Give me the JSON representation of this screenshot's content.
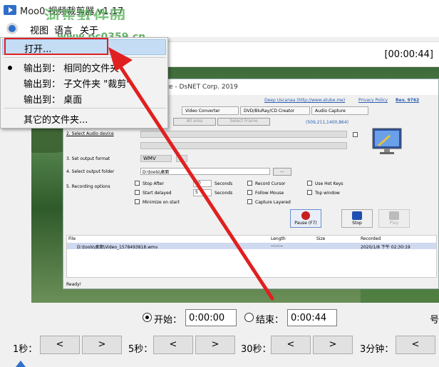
{
  "window": {
    "title": "Moo0 视频裁剪器 v1.17"
  },
  "watermark": {
    "text": "河东软件园",
    "url": "www.pc0359.cn"
  },
  "menubar": {
    "items": [
      "视图",
      "语言",
      "关于"
    ]
  },
  "time_readout": "[00:00:44]",
  "dropdown": {
    "open_label": "打开...",
    "output_same": "输出到：  相同的文件夹",
    "output_sub": "输出到：  子文件夹 \"裁剪\"",
    "output_desktop": "输出到：  桌面",
    "other_folder": "其它的文件夹...",
    "selected": "output_same"
  },
  "embedded_app": {
    "title_fragment": "ite - DsNET Corp. 2019",
    "link_1": "Deep Uscanaa (http://www.atube.me)",
    "link_2": "Privacy Policy",
    "link_3": "Rev. 9762",
    "tabs": [
      "Video Converter",
      "DVD/BluRay/CD Creator",
      "Audio Capture"
    ],
    "btn_all_area": "All area",
    "btn_select_frame": "Select Frame",
    "coords": "(509,211,1400,864)",
    "label_audio": "2. Select Audio device",
    "label_format": "3. Set output format",
    "format_value": "WMV",
    "label_folder": "4. Select output folder",
    "folder_value": "D:\\tools\\桌面",
    "browse": "...",
    "label_rec_options": "5. Recording options",
    "opt_stop_after": "Stop After",
    "stop_after_value": "60",
    "seconds_1": "Seconds",
    "opt_start_delayed": "Start delayed",
    "delay_value": "5",
    "seconds_2": "Seconds",
    "opt_minimize": "Minimize on start",
    "opt_record_cursor": "Record Cursor",
    "opt_follow_mouse": "Follow Mouse",
    "opt_capture_layered": "Capture Layered",
    "opt_hot_keys": "Use Hot Keys",
    "opt_top_window": "Top window",
    "btn_pause": "Pause (F7)",
    "btn_stop": "Stop",
    "btn_play": "Play",
    "table_headers": [
      "File",
      "Length",
      "Size",
      "Recorded"
    ],
    "table_row": {
      "file": "D:\\tools\\桌面\\Video_1578493818.wmv",
      "length": "--:--:--",
      "size": "",
      "recorded": "2020/1/8 下午 02:30:19"
    },
    "status": "Ready!"
  },
  "trim": {
    "start_label": "开始：",
    "start_value": "0:00:00",
    "end_label": "结束：",
    "end_value": "0:00:44",
    "right_cut_text": "号",
    "selected": "start"
  },
  "steps": [
    {
      "label": "1秒：",
      "back": "<",
      "forward": ">"
    },
    {
      "label": "5秒：",
      "back": "<",
      "forward": ">"
    },
    {
      "label": "30秒：",
      "back": "<",
      "forward": ">"
    },
    {
      "label": "3分钟：",
      "back": "<",
      "forward": ">"
    }
  ],
  "colors": {
    "annotation_red": "#e02020",
    "highlight": "#c4ddf5",
    "watermark_green": "#4caf50"
  }
}
